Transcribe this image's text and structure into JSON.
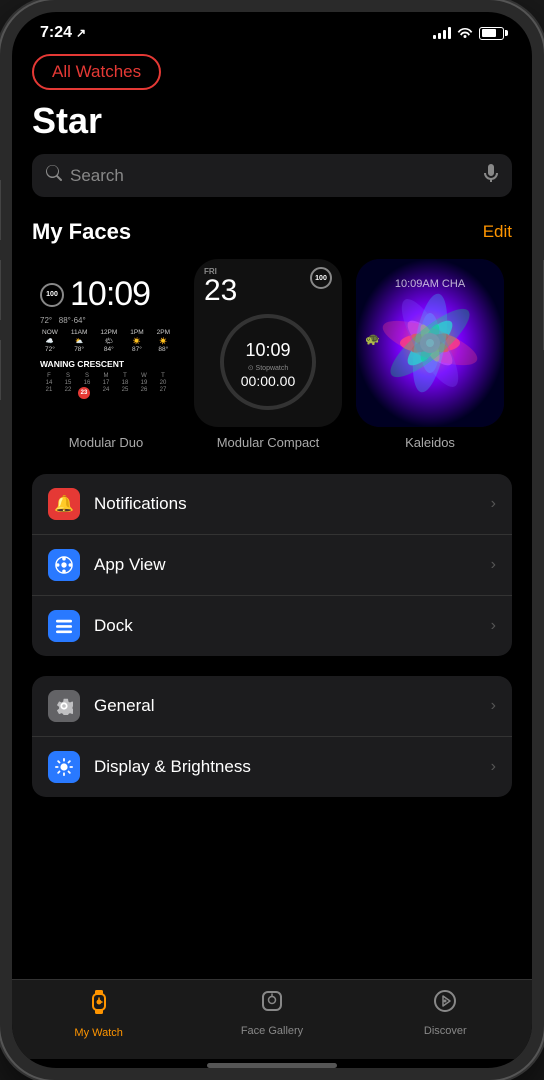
{
  "statusBar": {
    "time": "7:24",
    "locationArrow": "✈",
    "signalBars": [
      3,
      6,
      9,
      12
    ],
    "batteryPercent": 70
  },
  "nav": {
    "allWatchesLabel": "All Watches",
    "pageTitle": "Star"
  },
  "search": {
    "placeholder": "Search"
  },
  "myFaces": {
    "sectionTitle": "My Faces",
    "editLabel": "Edit",
    "faces": [
      {
        "name": "Modular Duo",
        "type": "modular-duo"
      },
      {
        "name": "Modular Compact",
        "type": "modular-compact"
      },
      {
        "name": "Kaleidos",
        "type": "kaleidoscope"
      }
    ]
  },
  "settings": {
    "sections": [
      {
        "items": [
          {
            "label": "Notifications",
            "icon": "🔔",
            "iconBg": "#e53935"
          },
          {
            "label": "App View",
            "icon": "⬡",
            "iconBg": "#2979ff"
          },
          {
            "label": "Dock",
            "icon": "≡",
            "iconBg": "#2979ff"
          }
        ]
      },
      {
        "items": [
          {
            "label": "General",
            "icon": "⚙",
            "iconBg": "#555"
          },
          {
            "label": "Display & Brightness",
            "icon": "☀",
            "iconBg": "#2979ff"
          }
        ]
      }
    ]
  },
  "tabBar": {
    "tabs": [
      {
        "label": "My Watch",
        "icon": "⌚",
        "active": true
      },
      {
        "label": "Face Gallery",
        "icon": "🕐",
        "active": false
      },
      {
        "label": "Discover",
        "icon": "🧭",
        "active": false
      }
    ]
  },
  "watchFace1": {
    "time": "10:09",
    "badge": "100",
    "tempHigh": "88°",
    "tempLow": "64°",
    "tempCurrent": "72°",
    "weatherTimes": [
      "NOW",
      "11AM",
      "12PM",
      "1PM",
      "2PM"
    ],
    "moonLabel": "WANING CRESCENT",
    "calDays": [
      "F",
      "S",
      "S",
      "M",
      "T",
      "W",
      "T",
      "14",
      "15",
      "16",
      "17",
      "18",
      "19",
      "20",
      "21",
      "22",
      "23",
      "24",
      "25",
      "26",
      "27"
    ]
  },
  "watchFace2": {
    "dayLabel": "FRI",
    "dateNum": "23",
    "badge": "100",
    "time": "10:09",
    "stopwatchLabel": "Stopwatch",
    "stopwatchTime": "00:00.00"
  },
  "watchFace3": {
    "timeLabel": "10:09AM"
  }
}
